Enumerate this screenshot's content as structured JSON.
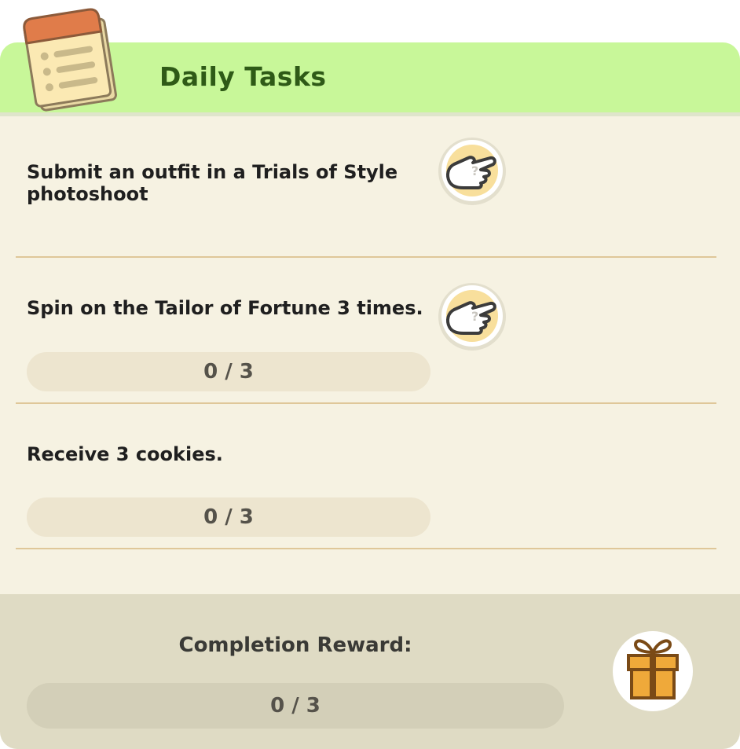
{
  "header": {
    "title": "Daily Tasks",
    "icon": "notepad-icon",
    "background": "#c8f799"
  },
  "tasks": [
    {
      "text": "Submit an outfit in a Trials of Style photoshoot",
      "go_icon": "pointing-hand-icon",
      "progress": null
    },
    {
      "text": "Spin on the Tailor of Fortune 3 times.",
      "go_icon": "pointing-hand-icon",
      "progress": {
        "current": 0,
        "total": 3,
        "label": "0 / 3"
      }
    },
    {
      "text": "Receive 3 cookies.",
      "go_icon": null,
      "progress": {
        "current": 0,
        "total": 3,
        "label": "0 / 3"
      }
    }
  ],
  "footer": {
    "reward_label": "Completion Reward:",
    "progress": {
      "current": 0,
      "total": 3,
      "label": "0 / 3"
    },
    "reward_icon": "gift-icon",
    "background": "#dfdbc4"
  }
}
